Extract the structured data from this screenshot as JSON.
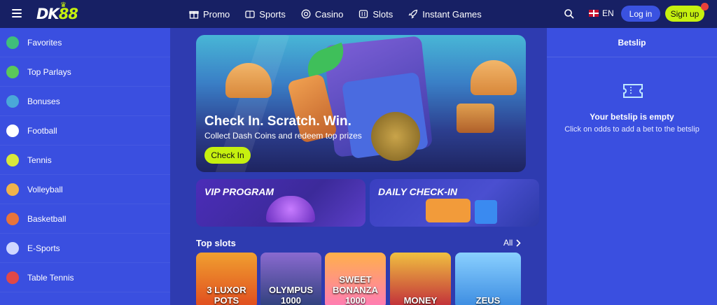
{
  "header": {
    "logo": {
      "letters": "DK",
      "number": "88"
    },
    "nav": [
      {
        "label": "Promo",
        "icon": "gift-icon"
      },
      {
        "label": "Sports",
        "icon": "scoreboard-icon"
      },
      {
        "label": "Casino",
        "icon": "chip-icon"
      },
      {
        "label": "Slots",
        "icon": "slot-machine-icon"
      },
      {
        "label": "Instant Games",
        "icon": "rocket-icon"
      }
    ],
    "language": "EN",
    "login_label": "Log in",
    "signup_label": "Sign up"
  },
  "sidebar": {
    "items": [
      {
        "label": "Favorites",
        "icon": "favorites-icon",
        "color": "#3fbf7a"
      },
      {
        "label": "Top Parlays",
        "icon": "stack-icon",
        "color": "#5ac85a"
      },
      {
        "label": "Bonuses",
        "icon": "globe-icon",
        "color": "#4aa8d8"
      },
      {
        "label": "Football",
        "icon": "football-icon",
        "color": "#ffffff"
      },
      {
        "label": "Tennis",
        "icon": "tennis-ball-icon",
        "color": "#d8e83a"
      },
      {
        "label": "Volleyball",
        "icon": "volleyball-icon",
        "color": "#f0b34a"
      },
      {
        "label": "Basketball",
        "icon": "basketball-icon",
        "color": "#e8743a"
      },
      {
        "label": "E-Sports",
        "icon": "gamepad-icon",
        "color": "#cfd6ff"
      },
      {
        "label": "Table Tennis",
        "icon": "ping-pong-icon",
        "color": "#e04848"
      }
    ]
  },
  "hero": {
    "title": "Check In. Scratch. Win.",
    "subtitle": "Collect Dash Coins and redeem top prizes",
    "button_label": "Check In"
  },
  "promos": [
    {
      "title": "VIP PROGRAM"
    },
    {
      "title": "DAILY CHECK-IN"
    }
  ],
  "top_slots": {
    "title": "Top slots",
    "all_label": "All",
    "games": [
      {
        "name": "3 LUXOR POTS",
        "colors": [
          "#e04a1e",
          "#f0a030"
        ]
      },
      {
        "name": "OLYMPUS 1000",
        "colors": [
          "#2d3f7a",
          "#8a6ad0"
        ]
      },
      {
        "name": "SWEET BONANZA 1000",
        "colors": [
          "#ff7ab8",
          "#ffb04a"
        ]
      },
      {
        "name": "MONEY",
        "colors": [
          "#c02a3a",
          "#f0c040"
        ]
      },
      {
        "name": "ZEUS",
        "colors": [
          "#3a8ae0",
          "#8ad0ff"
        ]
      }
    ]
  },
  "betslip": {
    "title": "Betslip",
    "empty_title": "Your betslip is empty",
    "empty_hint": "Click on odds to add a bet to the betslip"
  }
}
